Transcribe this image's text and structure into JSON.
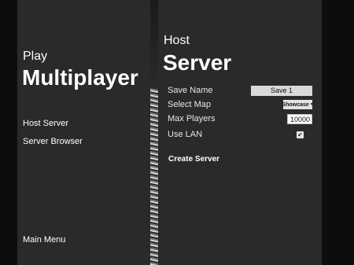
{
  "left": {
    "subtitle": "Play",
    "title": "Multiplayer",
    "menu": [
      {
        "label": "Host Server"
      },
      {
        "label": "Server Browser"
      }
    ],
    "footer_link": "Main Menu"
  },
  "right": {
    "subtitle": "Host",
    "title": "Server",
    "fields": {
      "save_name": {
        "label": "Save Name",
        "value": "Save 1"
      },
      "select_map": {
        "label": "Select Map",
        "value": "Showcase"
      },
      "max_players": {
        "label": "Max Players",
        "value": "10000"
      },
      "use_lan": {
        "label": "Use LAN",
        "checked": true,
        "check_glyph": "✔"
      }
    },
    "create_button": "Create Server"
  },
  "colors": {
    "panel": "#2a2a2a",
    "background": "#0d0d0d",
    "text": "#ffffff"
  }
}
